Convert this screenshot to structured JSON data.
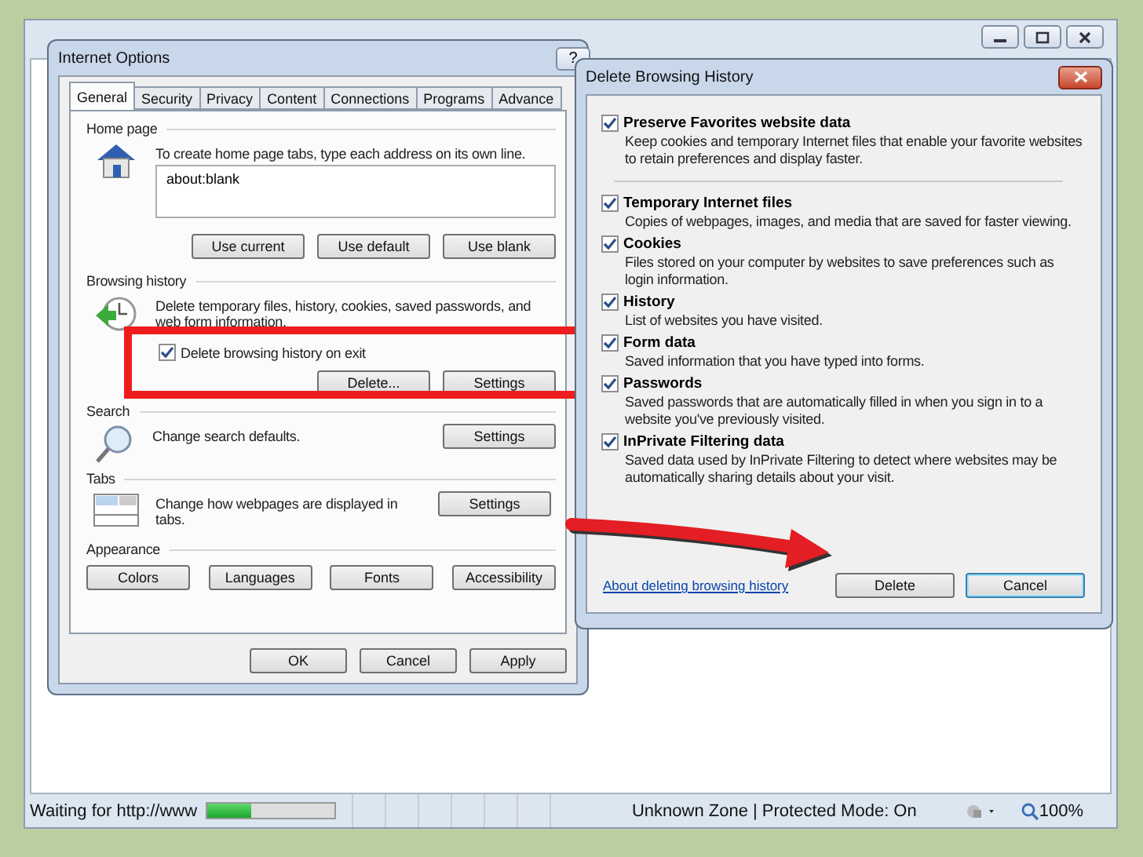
{
  "browser": {
    "status_bar": {
      "text": "Waiting for http://www",
      "progress": {
        "level": 0.35
      },
      "zone": "Unknown Zone | Protected Mode: On",
      "zoom": "100%"
    }
  },
  "internet_options": {
    "title": "Internet Options",
    "help": "?",
    "tabs": [
      {
        "label": "General",
        "selected": true
      },
      {
        "label": "Security",
        "selected": false
      },
      {
        "label": "Privacy",
        "selected": false
      },
      {
        "label": "Content",
        "selected": false
      },
      {
        "label": "Connections",
        "selected": false
      },
      {
        "label": "Programs",
        "selected": false
      },
      {
        "label": "Advance",
        "selected": false
      }
    ],
    "home_page": {
      "heading": "Home page",
      "text": "To create home page tabs, type each address on its own line.",
      "value": "about:blank",
      "buttons": [
        "Use current",
        "Use default",
        "Use blank"
      ]
    },
    "browsing_history": {
      "heading": "Browsing history",
      "text": "Delete temporary files, history, cookies, saved passwords, and web form information.",
      "checkbox": {
        "label": "Delete browsing history on exit",
        "checked": true
      },
      "buttons": [
        "Delete...",
        "Settings"
      ]
    },
    "search": {
      "heading": "Search",
      "text": "Change search defaults.",
      "button": "Settings"
    },
    "tabs_section": {
      "heading": "Tabs",
      "text": "Change how webpages are displayed in tabs.",
      "button": "Settings"
    },
    "appearance": {
      "heading": "Appearance",
      "buttons": [
        "Colors",
        "Languages",
        "Fonts",
        "Accessibility"
      ]
    },
    "footer_buttons": [
      "OK",
      "Cancel",
      "Apply"
    ]
  },
  "delete_dialog": {
    "title": "Delete Browsing History",
    "options": [
      {
        "label": "Preserve Favorites website data",
        "description": "Keep cookies and temporary Internet files that enable your favorite websites to retain preferences and display faster.",
        "checked": true,
        "separator_after": true
      },
      {
        "label": "Temporary Internet files",
        "description": "Copies of webpages, images, and media that are saved for faster viewing.",
        "checked": true,
        "separator_after": false
      },
      {
        "label": "Cookies",
        "description": "Files stored on your computer by websites to save preferences such as login information.",
        "checked": true,
        "separator_after": false
      },
      {
        "label": "History",
        "description": "List of websites you have visited.",
        "checked": true,
        "separator_after": false
      },
      {
        "label": "Form data",
        "description": "Saved information that you have typed into forms.",
        "checked": true,
        "separator_after": false
      },
      {
        "label": "Passwords",
        "description": "Saved passwords that are automatically filled in when you sign in to a website you've previously visited.",
        "checked": true,
        "separator_after": false
      },
      {
        "label": "InPrivate Filtering data",
        "description": "Saved data used by InPrivate Filtering to detect where websites may be automatically sharing details about your visit.",
        "checked": true,
        "separator_after": false
      }
    ],
    "link": "About deleting browsing history",
    "buttons": [
      {
        "label": "Delete",
        "default": false
      },
      {
        "label": "Cancel",
        "default": true
      }
    ]
  }
}
